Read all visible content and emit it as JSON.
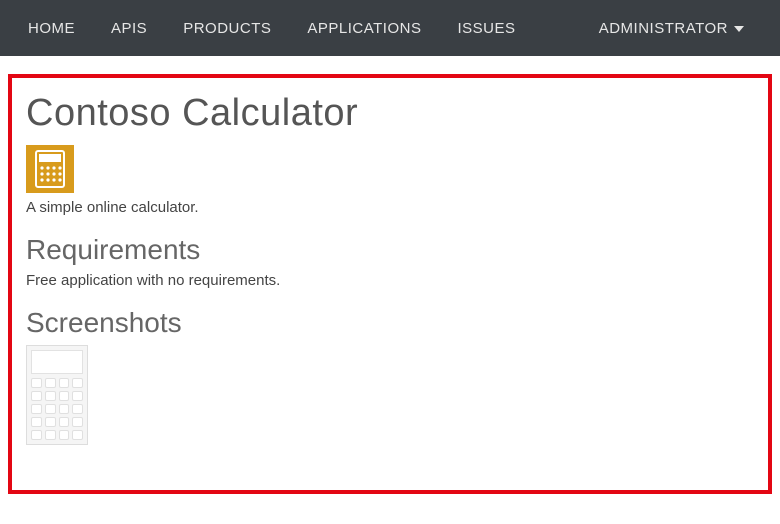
{
  "nav": {
    "items": [
      {
        "label": "HOME"
      },
      {
        "label": "APIS"
      },
      {
        "label": "PRODUCTS"
      },
      {
        "label": "APPLICATIONS"
      },
      {
        "label": "ISSUES"
      }
    ],
    "admin_label": "ADMINISTRATOR"
  },
  "app": {
    "title": "Contoso Calculator",
    "description": "A simple online calculator.",
    "icon": "calculator-icon",
    "sections": {
      "requirements": {
        "heading": "Requirements",
        "text": "Free application with no requirements."
      },
      "screenshots": {
        "heading": "Screenshots"
      }
    }
  },
  "colors": {
    "brand_amber": "#d89b1c",
    "nav_bg": "#3a3f44",
    "highlight_border": "#e30613"
  }
}
